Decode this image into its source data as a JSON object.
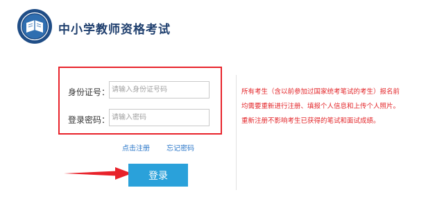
{
  "header": {
    "title": "中小学教师资格考试",
    "logo_icon": "teacher-exam-emblem-icon"
  },
  "login": {
    "id_label": "身份证号：",
    "id_placeholder": "请输入身份证号码",
    "password_label": "登录密码：",
    "password_placeholder": "请输入密码",
    "register_link": "点击注册",
    "forgot_link": "忘记密码",
    "submit_label": "登录"
  },
  "notice": {
    "lines": [
      "所有考生（含以前参加过国家统考笔试的考生）报名前",
      "均需要重新进行注册、填报个人信息和上传个人照片。",
      "重新注册不影响考生已获得的笔试和面试成绩。"
    ]
  },
  "colors": {
    "highlight_border": "#e8222a",
    "button_bg": "#2aa1da",
    "link": "#2b77c9",
    "notice_text": "#e3262a",
    "title": "#1f3f6e"
  }
}
